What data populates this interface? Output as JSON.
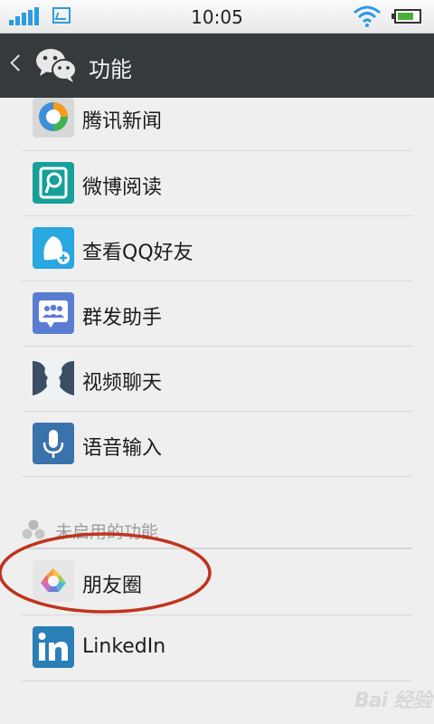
{
  "status_bar": {
    "time": "10:05"
  },
  "header": {
    "title": "功能"
  },
  "enabled_features": [
    {
      "label": "腾讯新闻",
      "icon": "tencent-news-icon"
    },
    {
      "label": "微博阅读",
      "icon": "weibo-reader-icon"
    },
    {
      "label": "查看QQ好友",
      "icon": "qq-friends-icon"
    },
    {
      "label": "群发助手",
      "icon": "mass-message-icon"
    },
    {
      "label": "视频聊天",
      "icon": "video-chat-icon"
    },
    {
      "label": "语音输入",
      "icon": "voice-input-icon"
    }
  ],
  "disabled_section": {
    "title": "未启用的功能",
    "items": [
      {
        "label": "朋友圈",
        "icon": "moments-icon"
      },
      {
        "label": "LinkedIn",
        "icon": "linkedin-icon"
      }
    ]
  },
  "colors": {
    "header_bg": "#353a3d",
    "accent_blue": "#2c9be0",
    "annotation_red": "#c0341d"
  },
  "watermark": {
    "text": "Bai 经验"
  }
}
